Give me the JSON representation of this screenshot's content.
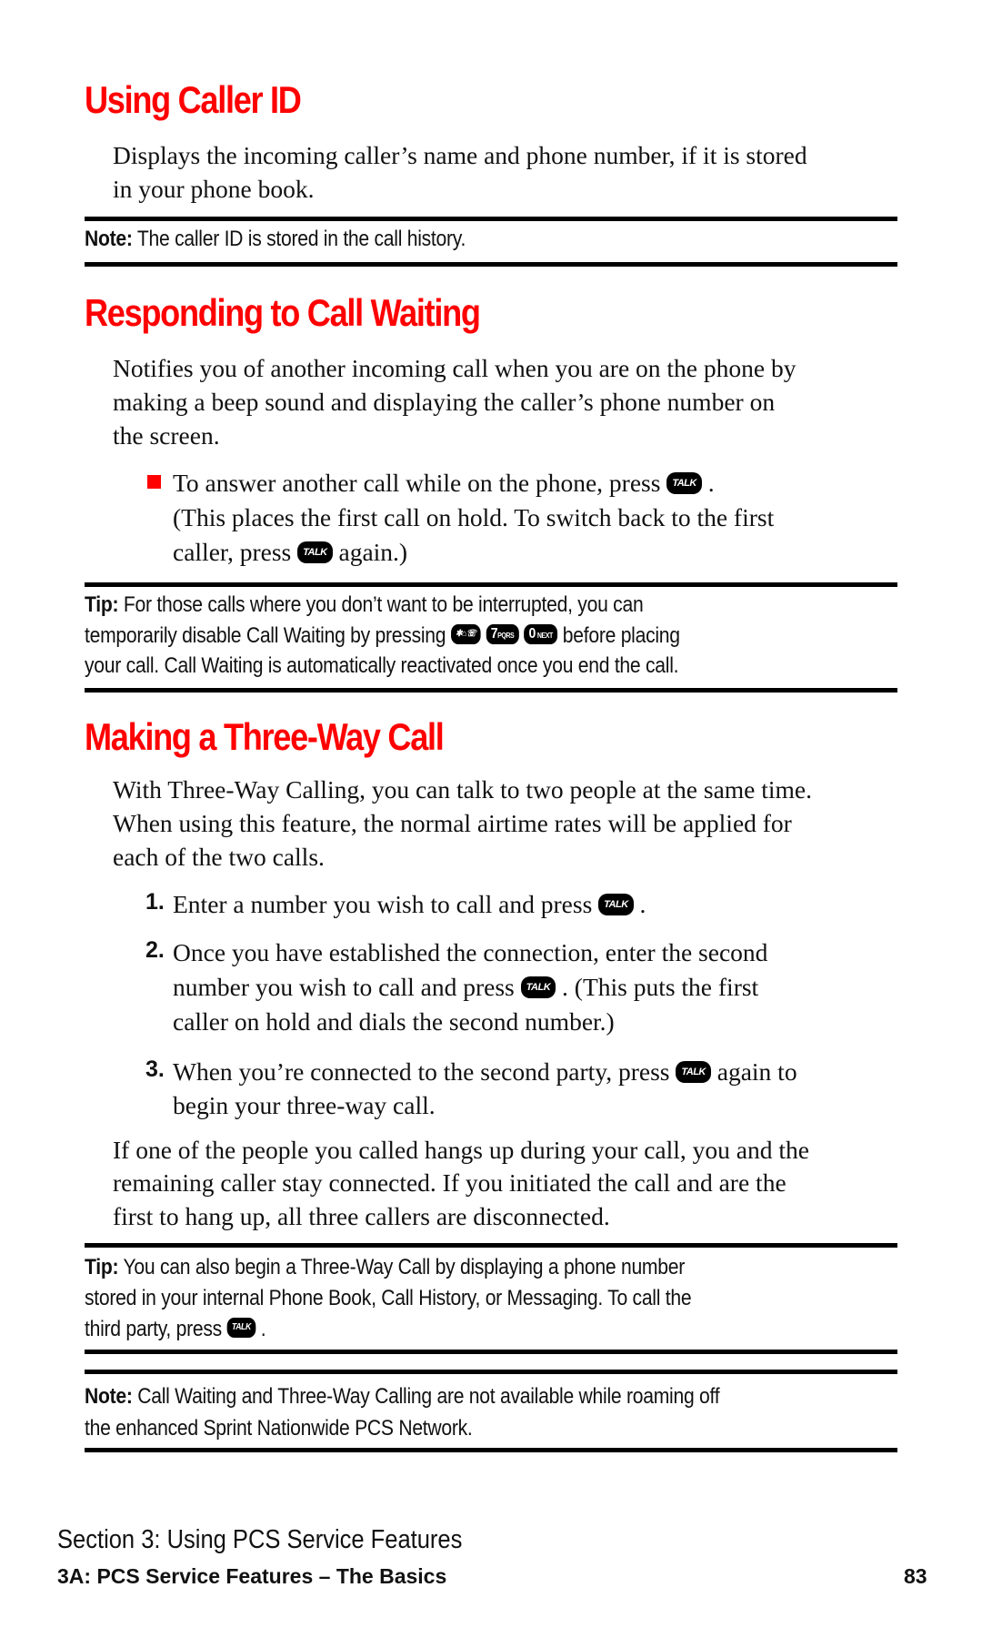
{
  "colors": {
    "heading": "#ff0000",
    "bullet": "#ff0000",
    "rule": "#000000",
    "text": "#111111"
  },
  "sections": {
    "caller_id": {
      "title": "Using Caller ID",
      "body": [
        "Displays the incoming caller’s name and phone number, if it is stored",
        "in your phone book."
      ],
      "note": {
        "label": "Note:",
        "text": " The caller ID is stored in the call history."
      }
    },
    "call_waiting": {
      "title": "Responding to Call Waiting",
      "body": [
        "Notifies you of another incoming call when you are on the phone by",
        "making a beep sound and displaying the caller’s phone number on",
        "the screen."
      ],
      "bullet": {
        "line1_pre": "To answer another call while on the phone, press",
        "line1_post": ".",
        "line2": "(This places the first call on hold. To switch back to the first",
        "line3_pre": "caller, press",
        "line3_post": "again.)"
      },
      "tip": {
        "label": "Tip:",
        "line1": " For those calls where you don’t want to be interrupted, you can",
        "line2_pre": "temporarily disable Call Waiting by pressing",
        "line2_post": "before placing",
        "line3": "your call. Call Waiting is automatically reactivated once you end the call."
      }
    },
    "three_way": {
      "title": "Making a Three-Way Call",
      "body": [
        "With Three-Way Calling, you can talk to two people at the same time.",
        "When using this feature, the normal airtime rates will be applied for",
        "each of the two calls."
      ],
      "steps": [
        {
          "num": "1.",
          "lines": [
            "Enter a number you wish to call and press",
            "."
          ]
        },
        {
          "num": "2.",
          "lines": [
            "Once you have established the connection, enter the second",
            "number you wish to call and press",
            ". (This puts the first",
            "caller on hold and dials the second number.)"
          ]
        },
        {
          "num": "3.",
          "lines": [
            "When you’re connected to the second party, press",
            "again to",
            "begin your three-way call."
          ]
        }
      ],
      "after": [
        "If one of the people you called hangs up during your call, you and the",
        "remaining caller stay connected. If you initiated the call and are the",
        "first to hang up, all three callers are disconnected."
      ],
      "tip": {
        "label": "Tip:",
        "line1": " You can also begin a Three-Way Call by displaying a phone number",
        "line2": "stored in your internal Phone Book, Call History, or Messaging. To call the",
        "line3_pre": "third party, press",
        "line3_post": "."
      },
      "note": {
        "label": "Note:",
        "line1": " Call Waiting and Three-Way Calling are not available while roaming off",
        "line2": "the enhanced Sprint Nationwide PCS Network."
      }
    }
  },
  "keys": {
    "talk": "TALK",
    "star": "✱⌂",
    "star_sub": "☏",
    "seven_main": "7",
    "seven_sub": "PQRS",
    "zero_main": "0",
    "zero_sub": "NEXT"
  },
  "footer": {
    "section": "Section 3: Using PCS Service Features",
    "chapter": "3A: PCS Service Features – The Basics",
    "page": "83"
  }
}
